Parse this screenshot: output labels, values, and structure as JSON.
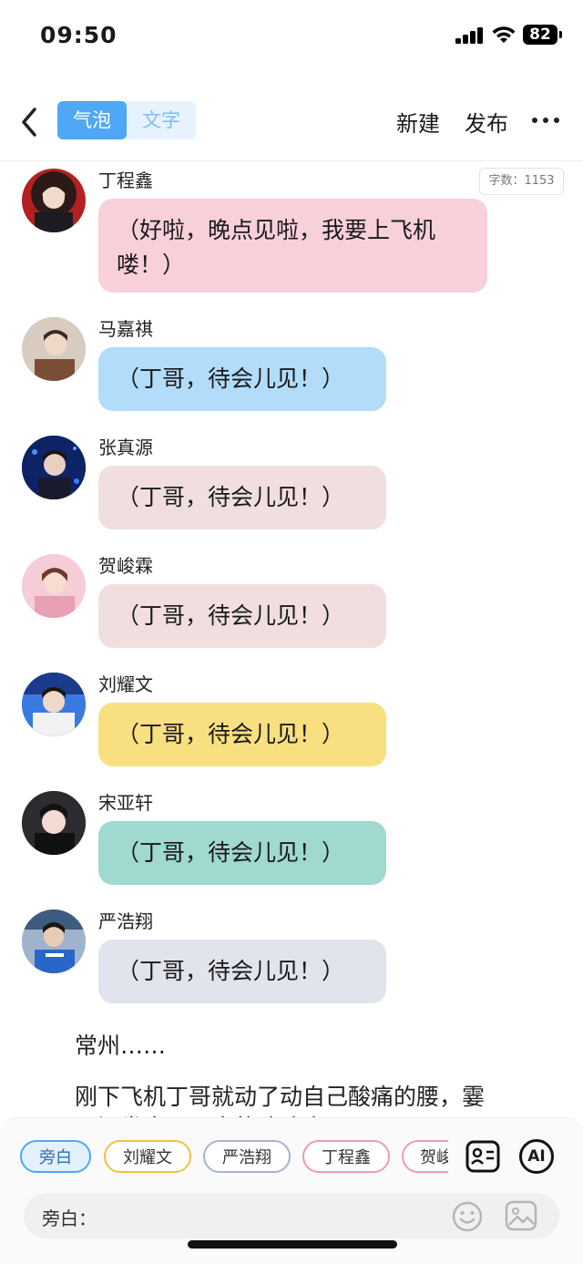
{
  "status_bar": {
    "time": "09:50",
    "battery": "82"
  },
  "nav": {
    "seg_bubble": "气泡",
    "seg_text": "文字",
    "new_label": "新建",
    "publish_label": "发布"
  },
  "word_count": "字数：1153",
  "messages": [
    {
      "name": "丁程鑫",
      "text": "（好啦，晚点见啦，我要上飞机喽！）",
      "color": "#f8d0da"
    },
    {
      "name": "马嘉祺",
      "text": "（丁哥，待会儿见！）",
      "color": "#b3dcfb"
    },
    {
      "name": "张真源",
      "text": "（丁哥，待会儿见！）",
      "color": "#f1dfe0"
    },
    {
      "name": "贺峻霖",
      "text": "（丁哥，待会儿见！）",
      "color": "#f1dfe0"
    },
    {
      "name": "刘耀文",
      "text": "（丁哥，待会儿见！）",
      "color": "#f8e080"
    },
    {
      "name": "宋亚轩",
      "text": "（丁哥，待会儿见！）",
      "color": "#9fd9cf"
    },
    {
      "name": "严浩翔",
      "text": "（丁哥，待会儿见！）",
      "color": "#e1e4ec"
    }
  ],
  "narration": {
    "line1": "常州……",
    "line2": "刚下飞机丁哥就动了动自己酸痛的腰，霎",
    "line3": "那间发出了巨大的咔咔声"
  },
  "chips": [
    {
      "label": "旁白",
      "color": "#4ea8f5",
      "selected": true
    },
    {
      "label": "刘耀文",
      "color": "#f0c040"
    },
    {
      "label": "严浩翔",
      "color": "#a8b4cc"
    },
    {
      "label": "丁程鑫",
      "color": "#f09aae"
    },
    {
      "label": "贺峻霖",
      "color": "#f09aae"
    }
  ],
  "tools": {
    "ai_label": "AI"
  },
  "input": {
    "label": "旁白："
  },
  "icons": [
    "back-chevron-icon",
    "more-icon",
    "contact-card-icon",
    "ai-icon",
    "emoji-icon",
    "image-icon",
    "wifi-icon",
    "signal-icon",
    "battery-icon"
  ]
}
